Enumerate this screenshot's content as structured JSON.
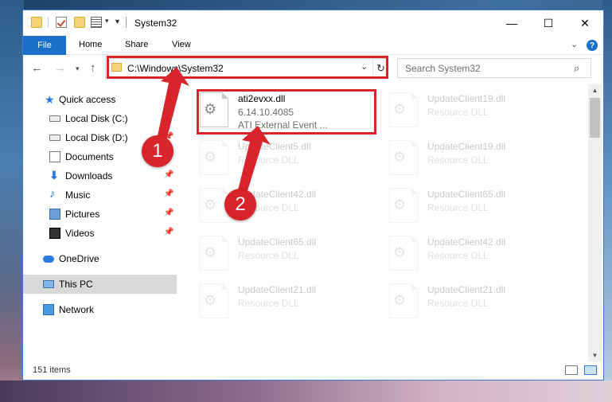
{
  "window": {
    "title": "System32"
  },
  "ribbon": {
    "tabs": [
      {
        "label": "File"
      },
      {
        "label": "Home"
      },
      {
        "label": "Share"
      },
      {
        "label": "View"
      }
    ],
    "help_label": "?"
  },
  "nav": {
    "address_path": "C:\\Windows\\System32",
    "search_placeholder": "Search System32"
  },
  "sidebar": {
    "items": [
      {
        "label": "Quick access",
        "icon": "star-icon"
      },
      {
        "label": "Local Disk (C:)",
        "icon": "disk-icon",
        "pinned": true
      },
      {
        "label": "Local Disk (D:)",
        "icon": "disk-icon",
        "pinned": true
      },
      {
        "label": "Documents",
        "icon": "documents-icon",
        "pinned": true
      },
      {
        "label": "Downloads",
        "icon": "download-icon",
        "pinned": true
      },
      {
        "label": "Music",
        "icon": "music-icon",
        "pinned": true
      },
      {
        "label": "Pictures",
        "icon": "pictures-icon",
        "pinned": true
      },
      {
        "label": "Videos",
        "icon": "videos-icon",
        "pinned": true
      },
      {
        "label": "OneDrive",
        "icon": "cloud-icon"
      },
      {
        "label": "This PC",
        "icon": "computer-icon",
        "selected": true
      },
      {
        "label": "Network",
        "icon": "network-icon"
      }
    ]
  },
  "files": {
    "highlighted": {
      "name": "ati2evxx.dll",
      "version": "6.14.10.4085",
      "description": "ATI External Event ..."
    },
    "others": [
      {
        "name": "UpdateClient19.dll",
        "type": "Resource DLL"
      },
      {
        "name": "UpdateClient5.dll",
        "type": "Resource DLL"
      },
      {
        "name": "UpdateClient19.dll",
        "type": "Resource DLL"
      },
      {
        "name": "UpdateClient42.dll",
        "type": "Resource DLL"
      },
      {
        "name": "UpdateClient65.dll",
        "type": "Resource DLL"
      },
      {
        "name": "UpdateClient65.dll",
        "type": "Resource DLL"
      },
      {
        "name": "UpdateClient42.dll",
        "type": "Resource DLL"
      },
      {
        "name": "UpdateClient21.dll",
        "type": "Resource DLL"
      },
      {
        "name": "UpdateClient21.dll",
        "type": "Resource DLL"
      }
    ]
  },
  "status": {
    "item_count": "151 items"
  },
  "callouts": {
    "step1": "1",
    "step2": "2"
  },
  "colors": {
    "accent": "#1a6fc9",
    "highlight": "#d9242b"
  }
}
